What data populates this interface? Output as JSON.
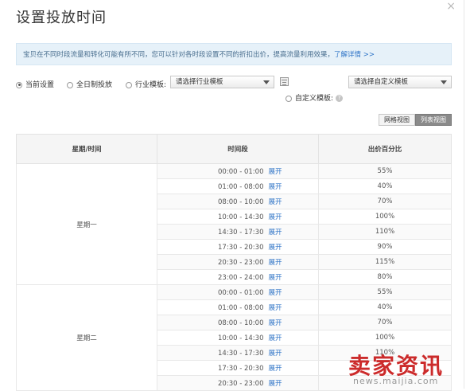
{
  "dialog": {
    "title": "设置投放时间",
    "close_label": "×"
  },
  "notice": {
    "text": "宝贝在不同时段流量和转化可能有所不同，您可以针对各时段设置不同的折扣出价，提高流量利用效果，",
    "link_label": "了解详情 >>"
  },
  "options": {
    "current_label": "当前设置",
    "allday_label": "全日制投放",
    "industry_label": "行业模板:",
    "industry_select": "请选择行业模板",
    "custom_label": "自定义模板:",
    "custom_select": "请选择自定义模板",
    "help_icon": "?"
  },
  "view_tabs": {
    "grid_label": "网格视图",
    "list_label": "列表视图",
    "active": "list"
  },
  "table": {
    "headers": [
      "星期/时间",
      "时间段",
      "出价百分比"
    ],
    "expand_label": "展开",
    "groups": [
      {
        "day": "星期一",
        "rows": [
          {
            "range": "00:00 - 01:00",
            "pct": "55%"
          },
          {
            "range": "01:00 - 08:00",
            "pct": "40%"
          },
          {
            "range": "08:00 - 10:00",
            "pct": "70%"
          },
          {
            "range": "10:00 - 14:30",
            "pct": "100%"
          },
          {
            "range": "14:30 - 17:30",
            "pct": "110%"
          },
          {
            "range": "17:30 - 20:30",
            "pct": "90%"
          },
          {
            "range": "20:30 - 23:00",
            "pct": "115%"
          },
          {
            "range": "23:00 - 24:00",
            "pct": "80%"
          }
        ]
      },
      {
        "day": "星期二",
        "rows": [
          {
            "range": "00:00 - 01:00",
            "pct": "55%"
          },
          {
            "range": "01:00 - 08:00",
            "pct": "40%"
          },
          {
            "range": "08:00 - 10:00",
            "pct": "70%"
          },
          {
            "range": "10:00 - 14:30",
            "pct": "100%"
          },
          {
            "range": "14:30 - 17:30",
            "pct": "110%"
          },
          {
            "range": "17:30 - 20:30",
            "pct": ""
          },
          {
            "range": "20:30 - 23:00",
            "pct": ""
          }
        ]
      }
    ]
  },
  "watermark": {
    "text": "卖家资讯",
    "url": "news.maijia.com"
  },
  "colors": {
    "link": "#2f74c7",
    "notice_bg": "#e6f1f9",
    "watermark": "#c81a1a"
  }
}
